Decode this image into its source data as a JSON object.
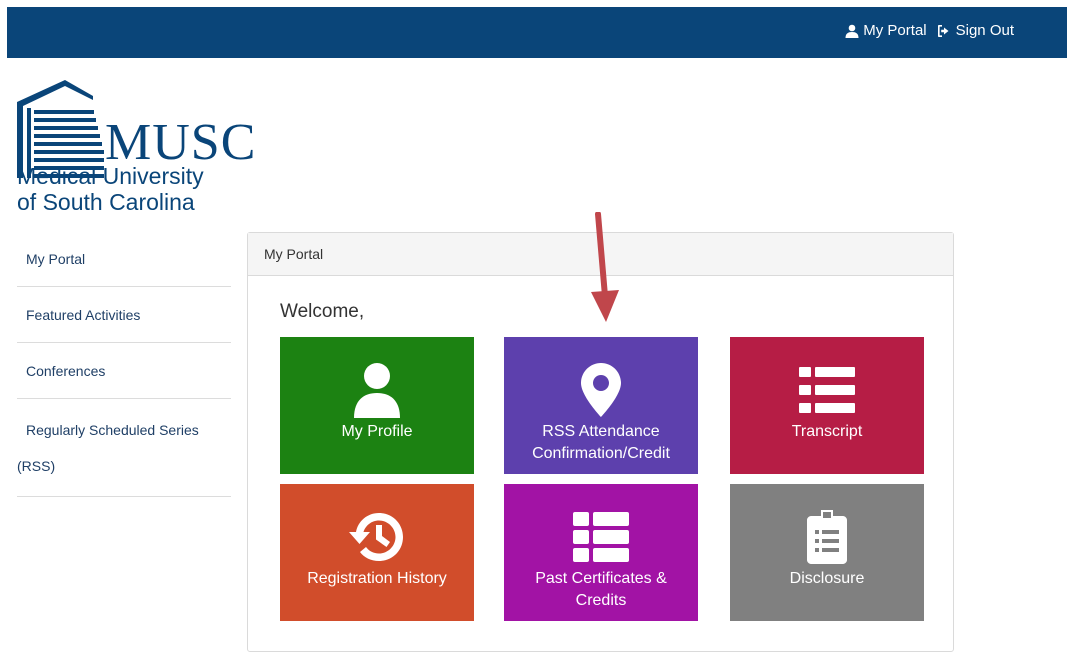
{
  "header": {
    "my_portal_label": "My Portal",
    "sign_out_label": "Sign Out",
    "background_color": "#0a4579"
  },
  "logo": {
    "wordmark": "MUSC",
    "line1": "Medical University",
    "line2": "of South Carolina"
  },
  "sidebar": {
    "items": [
      {
        "label": "My Portal"
      },
      {
        "label": "Featured Activities"
      },
      {
        "label": "Conferences"
      },
      {
        "label": "Regularly Scheduled Series"
      },
      {
        "label": "(RSS)"
      }
    ]
  },
  "panel": {
    "title": "My Portal",
    "welcome": "Welcome,"
  },
  "tiles": [
    {
      "label": "My Profile",
      "icon": "user-icon",
      "color": "#1c8212"
    },
    {
      "label_line1": "RSS Attendance",
      "label_line2": "Confirmation/Credit",
      "icon": "map-marker-icon",
      "color": "#5d40ad"
    },
    {
      "label": "Transcript",
      "icon": "list-icon",
      "color": "#b61d45"
    },
    {
      "label": "Registration History",
      "icon": "history-icon",
      "color": "#d14d2b"
    },
    {
      "label_line1": "Past Certificates &",
      "label_line2": "Credits",
      "icon": "th-list-icon",
      "color": "#a213a5"
    },
    {
      "label": "Disclosure",
      "icon": "clipboard-icon",
      "color": "#808080"
    }
  ],
  "annotation": {
    "arrow_color": "#c0464b"
  }
}
